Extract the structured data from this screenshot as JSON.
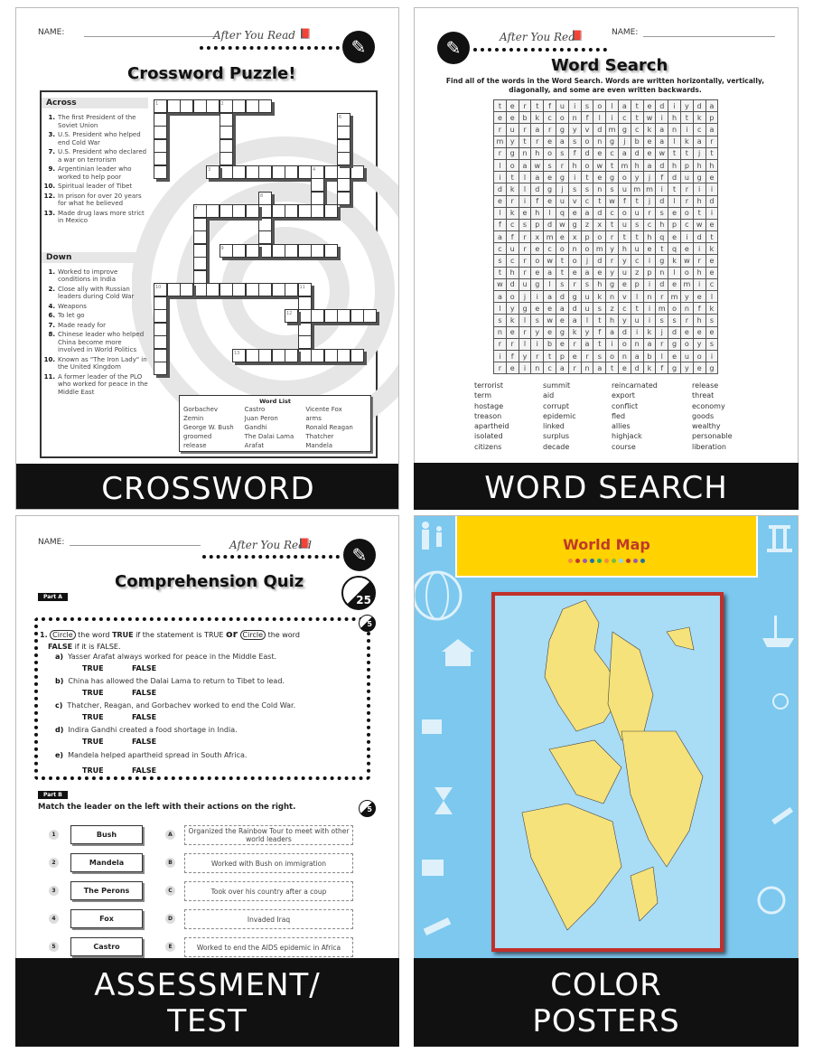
{
  "common": {
    "name_label": "NAME:",
    "after_you_read": "After You Read",
    "pencil_icon": "pencil-icon",
    "book_icon": "book-icon"
  },
  "crossword": {
    "title": "Crossword Puzzle!",
    "banner": "CROSSWORD",
    "across_label": "Across",
    "down_label": "Down",
    "across": [
      {
        "n": "1.",
        "t": "The first President of the Soviet Union"
      },
      {
        "n": "3.",
        "t": "U.S. President who helped end Cold War"
      },
      {
        "n": "7.",
        "t": "U.S. President who declared a war on terrorism"
      },
      {
        "n": "9.",
        "t": "Argentinian leader who worked to help poor"
      },
      {
        "n": "10.",
        "t": "Spiritual leader of Tibet"
      },
      {
        "n": "12.",
        "t": "In prison for over 20 years for what he believed"
      },
      {
        "n": "13.",
        "t": "Made drug laws more strict in Mexico"
      }
    ],
    "down": [
      {
        "n": "1.",
        "t": "Worked to improve conditions in India"
      },
      {
        "n": "2.",
        "t": "Close ally with Russian leaders during Cold War"
      },
      {
        "n": "4.",
        "t": "Weapons"
      },
      {
        "n": "6.",
        "t": "To let go"
      },
      {
        "n": "7.",
        "t": "Made ready for"
      },
      {
        "n": "8.",
        "t": "Chinese leader who helped China become more involved in World Politics"
      },
      {
        "n": "10.",
        "t": "Known as \"The Iron Lady\" in the United Kingdom"
      },
      {
        "n": "11.",
        "t": "A former leader of the PLO who worked for peace in the Middle East"
      }
    ],
    "grid_numbers": [
      "1",
      "2",
      "3",
      "4",
      "6",
      "7",
      "8",
      "9",
      "10",
      "11",
      "12",
      "13"
    ],
    "word_list_title": "Word List",
    "word_list": [
      "Gorbachev",
      "Castro",
      "Vicente Fox",
      "Zemin",
      "Juan Peron",
      "arms",
      "George W. Bush",
      "Gandhi",
      "Ronald Reagan",
      "groomed",
      "The Dalai Lama",
      "Thatcher",
      "release",
      "Arafat",
      "Mandela"
    ]
  },
  "wordsearch": {
    "title": "Word Search",
    "banner": "WORD SEARCH",
    "instructions": "Find all of the words in the Word Search. Words are written horizontally, vertically, diagonally, and some are even written backwards.",
    "grid": [
      "tertfuisolatediyda",
      "eebkconflictwihtkp",
      "rurargyvdmgckanica",
      "mytreasongjbealkar",
      "rgnhosfdecadewttjt",
      "loawsrhowtmhadhphh",
      "itlaegitegoyjfduge",
      "dkldgjssnsummitrii",
      "erifeuvctwftjdlrhd",
      "lkehlqeadcourseoti",
      "fcspdwgzxtuschpcwe",
      "afrxmexportthqeidt",
      "cureconomyhuetqeik",
      "scrowtojdrycigkwre",
      "threateaeyuzpnlohe",
      "wduglsrshgepidemic",
      "aojiadguknvlnrmyel",
      "lygeeaduszctimonfk",
      "sklswealthyuissrhs",
      "neryegkyfadikjdeee",
      "rrliberationargoys",
      "ifyrtpersonableuoi",
      "reincarnatedkfgyeg"
    ],
    "word_columns": [
      [
        "terrorist",
        "term",
        "hostage",
        "treason",
        "apartheid",
        "isolated",
        "citizens"
      ],
      [
        "summit",
        "aid",
        "corrupt",
        "epidemic",
        "linked",
        "surplus",
        "decade"
      ],
      [
        "reincarnated",
        "export",
        "conflict",
        "fled",
        "allies",
        "highjack",
        "course"
      ],
      [
        "release",
        "threat",
        "economy",
        "goods",
        "wealthy",
        "personable",
        "liberation"
      ]
    ]
  },
  "quiz": {
    "title": "Comprehension Quiz",
    "banner_line1": "ASSESSMENT/",
    "banner_line2": "TEST",
    "total_score": "25",
    "part_a": "Part A",
    "part_a_score": "5",
    "q1_num": "1.",
    "q1_circle": "Circle",
    "q1_text1": "the word",
    "q1_true": "TRUE",
    "q1_text2": "if the statement is TRUE",
    "q1_or": "or",
    "q1_text3": "the word",
    "q1_false": "FALSE",
    "q1_text4": "if it is FALSE.",
    "items": [
      {
        "l": "a)",
        "t": "Yasser Arafat always worked for peace in the Middle East."
      },
      {
        "l": "b)",
        "t": "China has allowed the Dalai Lama to return to Tibet to lead."
      },
      {
        "l": "c)",
        "t": "Thatcher, Reagan, and Gorbachev worked to end the Cold War."
      },
      {
        "l": "d)",
        "t": "Indira Gandhi created a food shortage in India."
      },
      {
        "l": "e)",
        "t": "Mandela helped apartheid spread in South Africa."
      }
    ],
    "true_label": "TRUE",
    "false_label": "FALSE",
    "part_b": "Part B",
    "part_b_score": "5",
    "part_b_instr": "Match the leader on the left with their actions on the right.",
    "left": [
      {
        "n": "1",
        "t": "Bush"
      },
      {
        "n": "2",
        "t": "Mandela"
      },
      {
        "n": "3",
        "t": "The Perons"
      },
      {
        "n": "4",
        "t": "Fox"
      },
      {
        "n": "5",
        "t": "Castro"
      }
    ],
    "right": [
      {
        "n": "A",
        "t": "Organized the Rainbow Tour to meet with other world leaders"
      },
      {
        "n": "B",
        "t": "Worked with Bush on immigration"
      },
      {
        "n": "C",
        "t": "Took over his country after a coup"
      },
      {
        "n": "D",
        "t": "Invaded Iraq"
      },
      {
        "n": "E",
        "t": "Worked to end the AIDS epidemic in Africa"
      }
    ]
  },
  "poster": {
    "title": "World Map",
    "banner_line1": "COLOR",
    "banner_line2": "POSTERS",
    "colors": {
      "background": "#7cc8ef",
      "header": "#ffd200",
      "title": "#c0392b",
      "frame": "#c0302a",
      "ocean": "#a9dcf5",
      "land": "#f6e27a"
    },
    "dot_colors": [
      "#f08a3c",
      "#c0392b",
      "#9b59b6",
      "#2471a3",
      "#27ae60",
      "#f08a3c",
      "#7dbb3c",
      "#8fd3f0",
      "#c0392b",
      "#9b59b6",
      "#2471a3"
    ]
  }
}
